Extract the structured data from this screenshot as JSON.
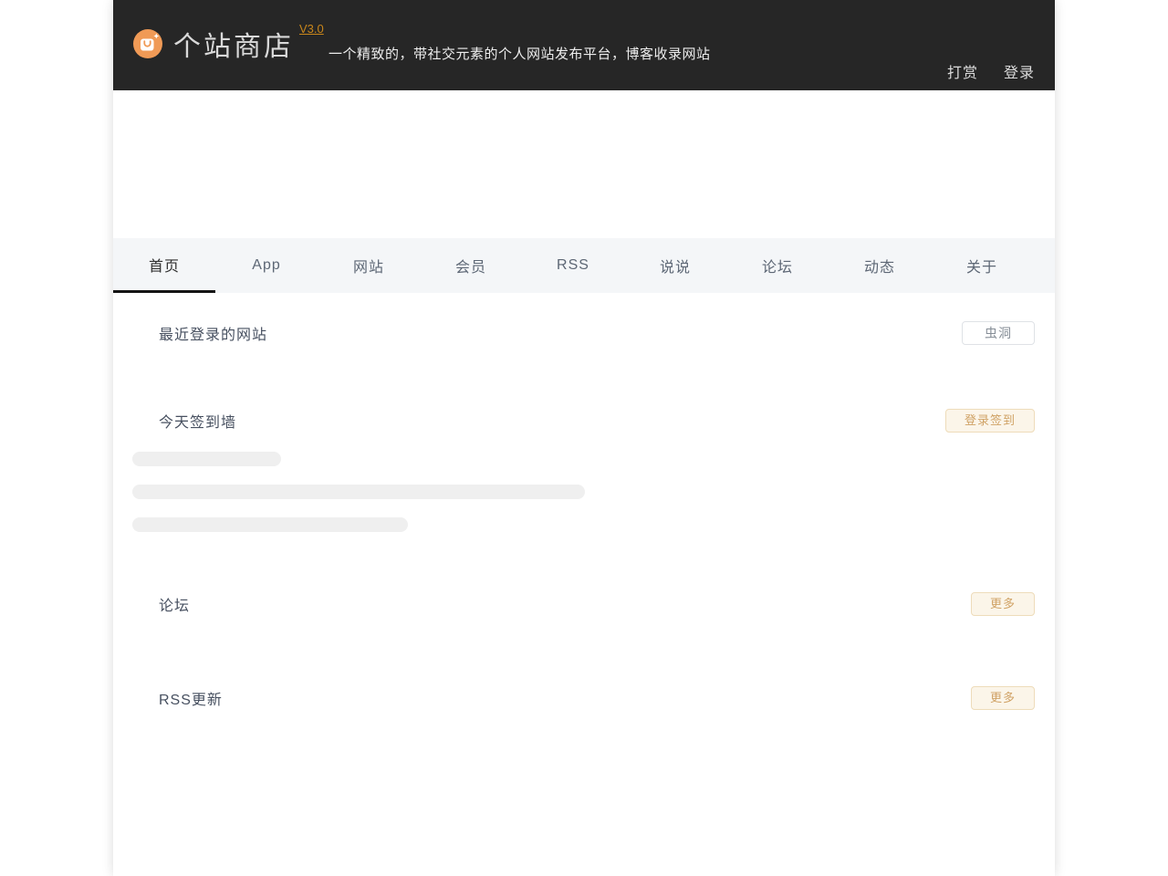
{
  "header": {
    "logo_icon": "shopping-bag-icon",
    "title": "个站商店",
    "version": "V3.0",
    "subtitle": "一个精致的，带社交元素的个人网站发布平台，博客收录网站",
    "actions": {
      "reward": "打赏",
      "login": "登录"
    }
  },
  "nav": {
    "tabs": [
      {
        "label": "首页",
        "active": true
      },
      {
        "label": "App",
        "active": false
      },
      {
        "label": "网站",
        "active": false
      },
      {
        "label": "会员",
        "active": false
      },
      {
        "label": "RSS",
        "active": false
      },
      {
        "label": "说说",
        "active": false
      },
      {
        "label": "论坛",
        "active": false
      },
      {
        "label": "动态",
        "active": false
      },
      {
        "label": "关于",
        "active": false
      }
    ]
  },
  "sections": {
    "recent": {
      "title": "最近登录的网站",
      "button": "虫洞"
    },
    "signin": {
      "title": "今天签到墙",
      "button": "登录签到",
      "loading_placeholder": true
    },
    "forum": {
      "title": "论坛",
      "button": "更多"
    },
    "rss": {
      "title": "RSS更新",
      "button": "更多"
    }
  },
  "colors": {
    "header_bg": "#262626",
    "brand_orange": "#f09a56",
    "version_link": "#c8861b",
    "nav_bg": "#f4f6f8",
    "active_tab_underline": "#141414",
    "warm_button_text": "#d0a265",
    "warm_button_bg": "#fbf5e9",
    "warm_button_border": "#eedcba",
    "skeleton": "#efefef"
  }
}
